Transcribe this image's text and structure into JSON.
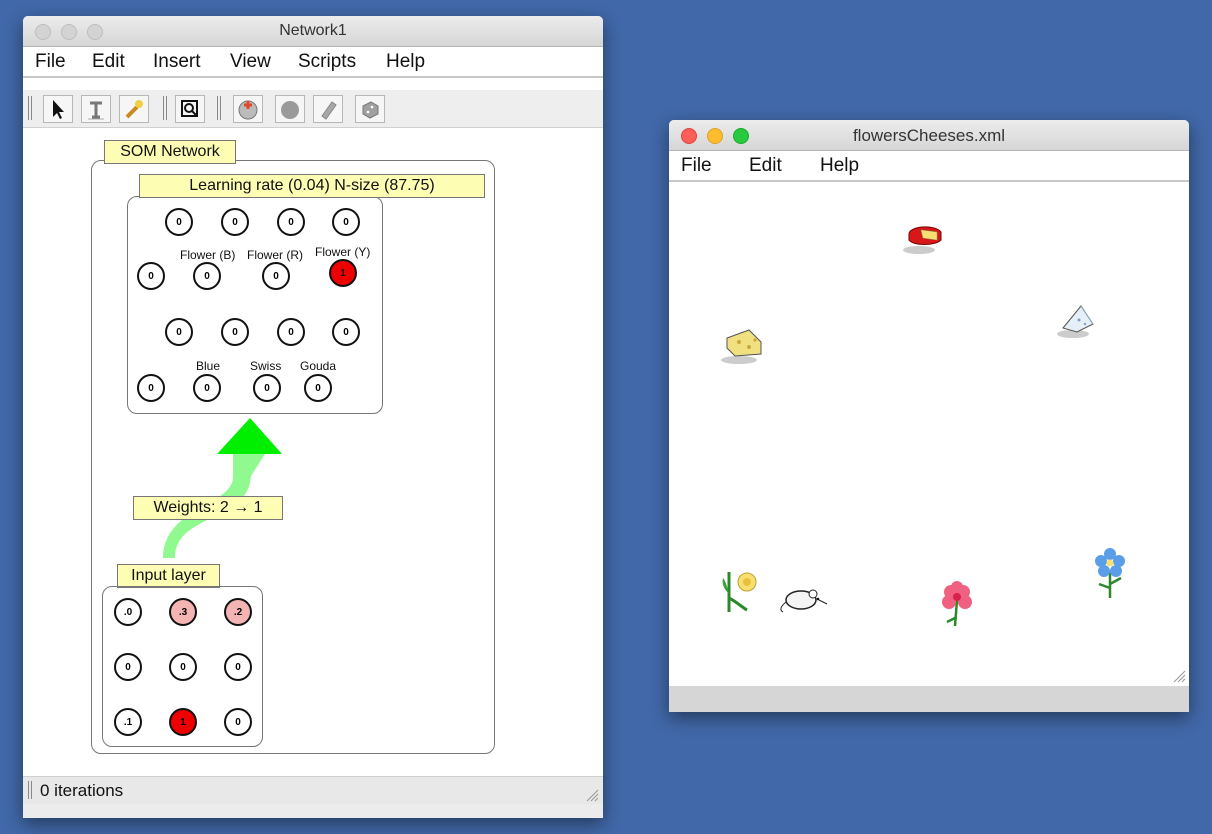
{
  "network_window": {
    "title": "Network1",
    "menu": [
      "File",
      "Edit",
      "Insert",
      "View",
      "Scripts",
      "Help"
    ],
    "toolbar_icons": [
      "select-arrow-icon",
      "text-tool-icon",
      "wand-tool-icon",
      "zoom-icon",
      "add-neuron-icon",
      "neuron-icon",
      "eraser-icon",
      "dice-icon"
    ],
    "som_label": "SOM Network",
    "som_params": "Learning rate (0.04) N-size (87.75)",
    "som_rows": [
      [
        "0",
        "0",
        "0",
        "0"
      ],
      [
        "0",
        "0",
        "0",
        "1"
      ],
      [
        "0",
        "0",
        "0",
        "0"
      ],
      [
        "0",
        "0",
        "0",
        "0"
      ]
    ],
    "som_labels": [
      "Flower (B)",
      "Flower (R)",
      "Flower (Y)",
      "Blue",
      "Swiss",
      "Gouda"
    ],
    "weights_label": "Weights: 2 → 1",
    "input_label": "Input layer",
    "input_rows": [
      [
        ".0",
        ".3",
        ".2"
      ],
      [
        "0",
        "0",
        "0"
      ],
      [
        ".1",
        "1",
        "0"
      ]
    ],
    "status": "0 iterations",
    "colors": {
      "active": "#ee0000",
      "partial": "#f4b4b4",
      "arrow": "#00ee00",
      "arrow_body": "#90fa90"
    }
  },
  "world_window": {
    "title": "flowersCheeses.xml",
    "menu": [
      "File",
      "Edit",
      "Help"
    ],
    "objects": [
      "red-cheese-icon",
      "swiss-cheese-icon",
      "blue-cheese-icon",
      "yellow-flower-icon",
      "mouse-icon",
      "red-flower-icon",
      "blue-flower-icon"
    ]
  }
}
